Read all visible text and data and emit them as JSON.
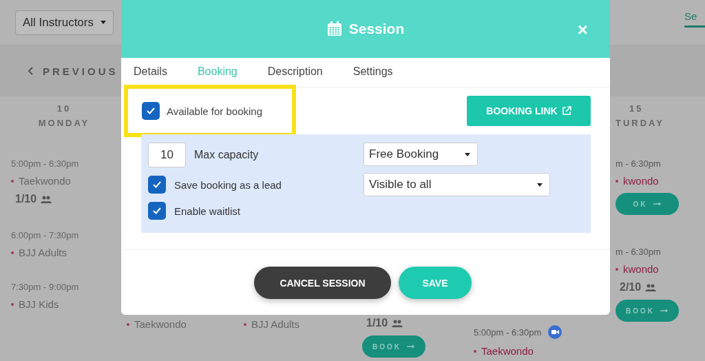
{
  "filter": {
    "label": "All Instructors"
  },
  "view_tab": {
    "label": "Se",
    "selected": true
  },
  "nav": {
    "previous": "PREVIOUS"
  },
  "days": [
    {
      "date": "10",
      "weekday": "MONDAY",
      "sessions": [
        {
          "time": "5:00pm - 6:30pm",
          "name": "Taekwondo",
          "faded": true,
          "count": "1/10"
        },
        {
          "time": "6:00pm - 7:30pm",
          "name": "BJJ Adults",
          "faded": true
        },
        {
          "time": "7:30pm - 9:00pm",
          "name": "BJJ Kids",
          "faded": true
        }
      ]
    },
    {
      "sessions": [
        {
          "name": "Taekwondo",
          "faded": true
        }
      ]
    },
    {
      "sessions": [
        {
          "name": "BJJ Adults",
          "faded": true
        }
      ]
    },
    {
      "sessions": [
        {
          "count": "1/10",
          "book": "BOOK"
        }
      ]
    },
    {
      "sessions": [
        {
          "time": "5:00pm - 6:30pm",
          "video": true,
          "name": "Taekwondo",
          "faded": false
        }
      ]
    },
    {
      "date": "15",
      "weekday": "TURDAY",
      "sessions": [
        {
          "time": "m - 6:30pm",
          "name": "kwondo",
          "faded": false,
          "book": "OK"
        },
        {
          "time": "m - 6:30pm",
          "name": "kwondo",
          "faded": false,
          "count": "2/10",
          "book": "BOOK"
        }
      ]
    }
  ],
  "modal": {
    "title": "Session",
    "close": "×",
    "tabs": [
      {
        "label": "Details",
        "selected": false
      },
      {
        "label": "Booking",
        "selected": true
      },
      {
        "label": "Description",
        "selected": false
      },
      {
        "label": "Settings",
        "selected": false
      }
    ],
    "available": {
      "label": "Available for booking",
      "checked": true,
      "highlighted": true
    },
    "booking_link": "BOOKING LINK",
    "capacity": {
      "value": "10",
      "label": "Max capacity"
    },
    "booking_type": {
      "value": "Free Booking"
    },
    "options": [
      {
        "label": "Save booking as a lead",
        "checked": true
      },
      {
        "label": "Enable waitlist",
        "checked": true
      }
    ],
    "visibility": {
      "value": "Visible to all"
    },
    "buttons": [
      {
        "label": "CANCEL SESSION",
        "kind": "dark"
      },
      {
        "label": "SAVE",
        "kind": "primary"
      }
    ]
  }
}
